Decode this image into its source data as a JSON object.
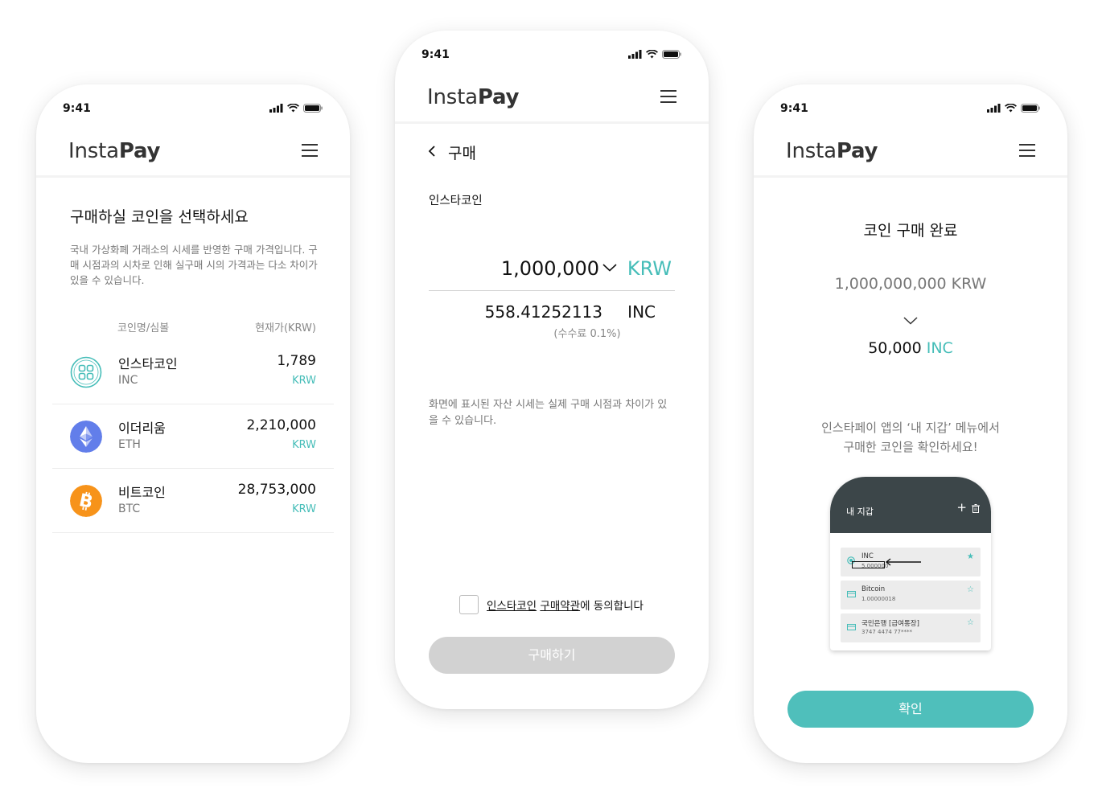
{
  "status_time": "9:41",
  "brand": {
    "light": "Insta",
    "bold": "Pay"
  },
  "colors": {
    "accent": "#45bdb8",
    "disabled_button": "#d2d2d2",
    "wallet_header": "#3c4649"
  },
  "coin_select": {
    "heading": "구매하실 코인을 선택하세요",
    "description": "국내 가상화폐 거래소의 시세를 반영한 구매 가격입니다. 구매 시점과의 시차로 인해 실구매 시의 가격과는 다소 차이가 있을 수 있습니다.",
    "col_name": "코인명/심볼",
    "col_price": "현재가(KRW)",
    "coins": [
      {
        "name": "인스타코인",
        "symbol": "INC",
        "price": "1,789",
        "currency": "KRW",
        "icon": "instacoin-icon"
      },
      {
        "name": "이더리움",
        "symbol": "ETH",
        "price": "2,210,000",
        "currency": "KRW",
        "icon": "ethereum-icon"
      },
      {
        "name": "비트코인",
        "symbol": "BTC",
        "price": "28,753,000",
        "currency": "KRW",
        "icon": "bitcoin-icon"
      }
    ]
  },
  "purchase": {
    "back_icon": "chevron-left-icon",
    "title": "구매",
    "coin_label": "인스타코인",
    "amount": "1,000,000",
    "amount_currency": "KRW",
    "result_amount": "558.41252113",
    "result_currency": "INC",
    "fee": "(수수료 0.1%)",
    "notice": "화면에 표시된 자산 시세는 실제 구매 시점과 차이가 있을 수 있습니다.",
    "agree_link1": "인스타코인",
    "agree_link2": "구매약관",
    "agree_suffix": "에 동의합니다",
    "buy_button": "구매하기"
  },
  "complete": {
    "title": "코인 구매 완료",
    "paid": "1,000,000,000 KRW",
    "received_amount": "50,000",
    "received_currency": "INC",
    "guide_line1": "인스타페이 앱의 ‘내 지갑’ 메뉴에서",
    "guide_line2": "구매한 코인을 확인하세요!",
    "wallet": {
      "title": "내 지갑",
      "add": "+",
      "cards": [
        {
          "name": "INC",
          "value": "5.000000"
        },
        {
          "name": "Bitcoin",
          "value": "1.00000018"
        },
        {
          "name": "국민은행 [급여통장]",
          "value": "3747 4474 77****"
        }
      ]
    },
    "confirm_button": "확인"
  }
}
